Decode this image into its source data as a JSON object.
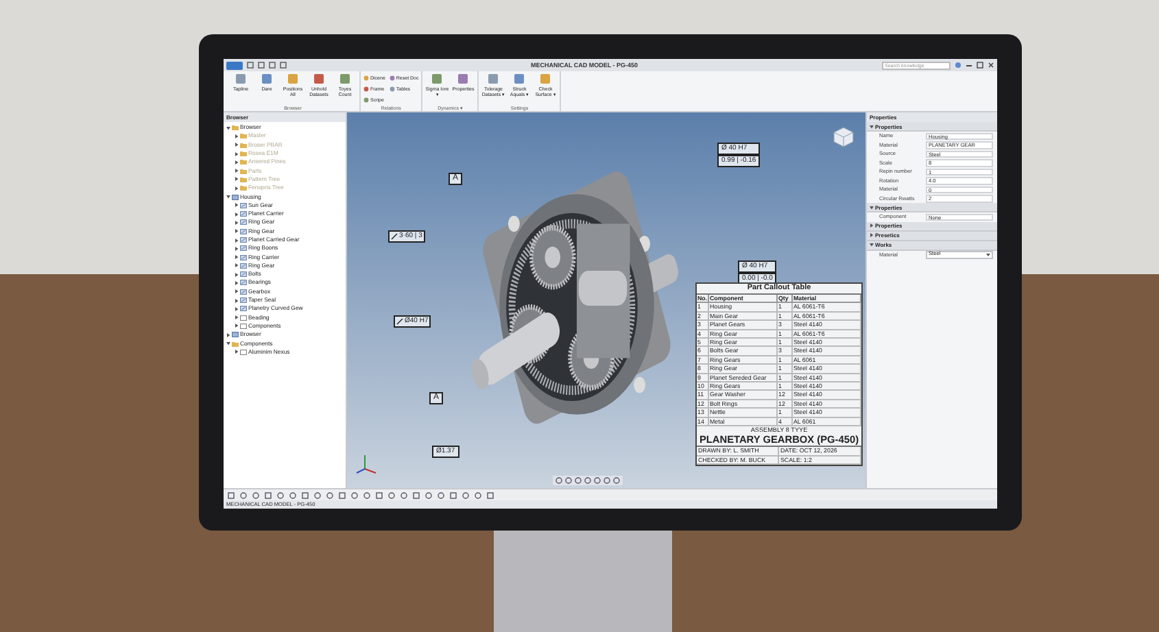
{
  "window": {
    "title": "MECHANICAL CAD MODEL - PG-450",
    "search": {
      "placeholder": "Search knowledge"
    }
  },
  "ribbon": {
    "groups": [
      {
        "label": "Browser",
        "buttons": [
          {
            "label": "Tapline",
            "kind": "large"
          },
          {
            "label": "Dare",
            "kind": "large"
          },
          {
            "label": "Positions All",
            "kind": "large"
          },
          {
            "label": "Unhold Datasets",
            "kind": "large"
          },
          {
            "label": "Toyes Count",
            "kind": "large"
          }
        ]
      },
      {
        "label": "Relations",
        "buttons": [
          {
            "label": "Dicene",
            "kind": "small"
          },
          {
            "label": "Frame",
            "kind": "small"
          },
          {
            "label": "Scripe",
            "kind": "small"
          },
          {
            "label": "Reset Doc",
            "kind": "small"
          },
          {
            "label": "Tables",
            "kind": "small"
          }
        ]
      },
      {
        "label": "Dynamics ▾",
        "buttons": [
          {
            "label": "Sigma Iore ▾",
            "kind": "large"
          },
          {
            "label": "Properties",
            "kind": "large"
          }
        ]
      },
      {
        "label": "Settings",
        "buttons": [
          {
            "label": "Tolerage Datasets ▾",
            "kind": "large"
          },
          {
            "label": "Struck Aquals ▾",
            "kind": "large"
          },
          {
            "label": "Check Surface ▾",
            "kind": "large"
          }
        ]
      }
    ]
  },
  "browser": {
    "title": "Browser",
    "tree": [
      {
        "label": "Browser",
        "kind": "folder",
        "expanded": true,
        "disabled": false,
        "children": [
          {
            "label": "Master",
            "kind": "folder",
            "expanded": false,
            "disabled": true
          },
          {
            "label": "Broser PBAR",
            "kind": "folder",
            "expanded": false,
            "disabled": true
          },
          {
            "label": "Rosea E1M",
            "kind": "folder",
            "expanded": false,
            "disabled": true
          },
          {
            "label": "Ansered Pines",
            "kind": "folder",
            "expanded": false,
            "disabled": true
          },
          {
            "label": "Parts",
            "kind": "folder",
            "expanded": false,
            "disabled": true
          },
          {
            "label": "Pattern Tree",
            "kind": "folder",
            "expanded": false,
            "disabled": true
          },
          {
            "label": "Fenopris Tree",
            "kind": "folder",
            "expanded": false,
            "disabled": true
          }
        ]
      },
      {
        "label": "Housing",
        "kind": "assembly",
        "expanded": true,
        "disabled": false,
        "children": [
          {
            "label": "Sun Gear",
            "kind": "part",
            "expanded": false,
            "disabled": false
          },
          {
            "label": "Planet Carrier",
            "kind": "part",
            "expanded": false,
            "disabled": false
          },
          {
            "label": "Ring Gear",
            "kind": "part",
            "expanded": false,
            "disabled": false
          },
          {
            "label": "Ring Gear",
            "kind": "part",
            "expanded": false,
            "disabled": false
          },
          {
            "label": "Planet Carried Gear",
            "kind": "part",
            "expanded": false,
            "disabled": false
          },
          {
            "label": "Ring Boons",
            "kind": "part",
            "expanded": false,
            "disabled": false
          },
          {
            "label": "Ring Carrier",
            "kind": "part",
            "expanded": false,
            "disabled": false
          },
          {
            "label": "Ring Gear",
            "kind": "part",
            "expanded": false,
            "disabled": false
          },
          {
            "label": "Bolts",
            "kind": "part",
            "expanded": false,
            "disabled": false
          },
          {
            "label": "Bearings",
            "kind": "part",
            "expanded": false,
            "disabled": false
          },
          {
            "label": "Gearbox",
            "kind": "part",
            "expanded": false,
            "disabled": false
          },
          {
            "label": "Taper Seal",
            "kind": "part",
            "expanded": false,
            "disabled": false
          },
          {
            "label": "Planetry Curved Gew",
            "kind": "part",
            "expanded": false,
            "disabled": false
          },
          {
            "label": "Beading",
            "kind": "sketch",
            "expanded": false,
            "disabled": false
          },
          {
            "label": "Components",
            "kind": "sketch",
            "expanded": false,
            "disabled": false
          }
        ]
      },
      {
        "label": "Browser",
        "kind": "assembly",
        "expanded": false,
        "disabled": false
      },
      {
        "label": "Components",
        "kind": "folder",
        "expanded": true,
        "disabled": false,
        "children": [
          {
            "label": "Aluminim Nexus",
            "kind": "sketch",
            "expanded": false,
            "disabled": false
          }
        ]
      }
    ]
  },
  "viewport": {
    "callouts": [
      {
        "kind": "datum",
        "text": "A"
      },
      {
        "kind": "feature",
        "text": "3·60 | 3"
      },
      {
        "kind": "feature",
        "text": "Ø40 H7"
      },
      {
        "kind": "datum",
        "text": "A"
      },
      {
        "kind": "dimension",
        "text": "Ø1.37"
      },
      {
        "kind": "tolerance",
        "text": "Ø 40 H7",
        "sub": "0.99 | -0.16"
      },
      {
        "kind": "tolerance",
        "text": "Ø 40 H7",
        "sub": "0.00 | -0.0"
      }
    ],
    "table": {
      "title": "Part Callout Table",
      "columns": [
        "No.",
        "Component",
        "Qty",
        "Material"
      ],
      "rows": [
        [
          "1",
          "Housing",
          "1",
          "AL 6061-T6"
        ],
        [
          "2",
          "Main Gear",
          "1",
          "AL 6061-T6"
        ],
        [
          "3",
          "Planet Gears",
          "3",
          "Steel 4140"
        ],
        [
          "4",
          "Ring Gear",
          "1",
          "AL 6061-T6"
        ],
        [
          "5",
          "Ring Gear",
          "1",
          "Steel 4140"
        ],
        [
          "6",
          "Bolts Gear",
          "3",
          "Steel 4140"
        ],
        [
          "7",
          "Ring Gears",
          "1",
          "AL 6061"
        ],
        [
          "8",
          "Ring Gear",
          "1",
          "Steel 4140"
        ],
        [
          "9",
          "Planet Sereded Gear",
          "1",
          "Steel 4140"
        ],
        [
          "10",
          "Ring Gears",
          "1",
          "Steel 4140"
        ],
        [
          "11",
          "Gear Washer",
          "12",
          "Steel 4140"
        ],
        [
          "12",
          "Bolt Rings",
          "12",
          "Steel 4140"
        ],
        [
          "13",
          "Nettle",
          "1",
          "Steel 4140"
        ],
        [
          "14",
          "Metal",
          "4",
          "AL 6061"
        ]
      ],
      "assembly": "ASSEMBLY 8 TYYE",
      "name": "PLANETARY GEARBOX (PG-450)",
      "footer": [
        "DRAWN BY: L. SMITH",
        "DATE: OCT 12, 2026",
        "CHECKED BY: M. BUCK",
        "SCALE: 1:2"
      ]
    }
  },
  "properties": {
    "title": "Properties",
    "sections": [
      {
        "title": "Properties",
        "expanded": true,
        "rows": [
          {
            "label": "Name",
            "value": "Housing"
          },
          {
            "label": "Material",
            "value": "PLANETARY GEAR"
          },
          {
            "label": "Source",
            "value": "Steel"
          },
          {
            "label": "Scale",
            "value": "8"
          },
          {
            "label": "Repin number",
            "value": "1"
          },
          {
            "label": "Rotation",
            "value": "4.0"
          },
          {
            "label": "Material",
            "value": "0"
          },
          {
            "label": "Circular Rwatts",
            "value": "2"
          }
        ]
      },
      {
        "title": "Properties",
        "expanded": true,
        "rows": [
          {
            "label": "Component",
            "value": "None"
          }
        ]
      },
      {
        "title": "Properties",
        "expanded": false
      },
      {
        "title": "Presetics",
        "expanded": false
      },
      {
        "title": "Works",
        "expanded": true,
        "rows": [
          {
            "label": "Material",
            "value": "Steel",
            "kind": "dropdown"
          }
        ]
      }
    ]
  },
  "status_bar": {
    "text": "MECHANICAL CAD MODEL - PG-450"
  }
}
